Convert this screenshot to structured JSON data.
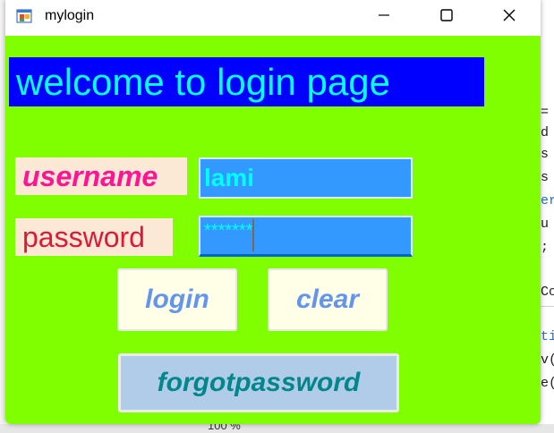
{
  "window": {
    "title": "mylogin",
    "background_color": "#80ff00",
    "controls": {
      "minimize": "minimize-icon",
      "maximize": "maximize-icon",
      "close": "close-icon"
    }
  },
  "form": {
    "heading": "welcome to login page",
    "username_label": "username",
    "password_label": "password",
    "username_value": "lami",
    "password_value": "*******",
    "login_label": "login",
    "clear_label": "clear",
    "forgot_label": "forgotpassword"
  },
  "background": {
    "code_lines": [
      "=",
      "d",
      "s",
      "s",
      "er",
      "u =",
      ";"
    ],
    "lower_code_lines": [
      "Co",
      "tic",
      "v(",
      "e("
    ],
    "zoom": "100 %"
  },
  "colors": {
    "heading_bg": "#0000ff",
    "heading_text": "#00ffff",
    "username_label_text": "#ff1493",
    "password_label_text": "#dc1a37",
    "field_bg": "#3399ff",
    "button_text": "#6495ed",
    "forgot_bg": "#b0cce8",
    "forgot_text": "#00868b"
  }
}
